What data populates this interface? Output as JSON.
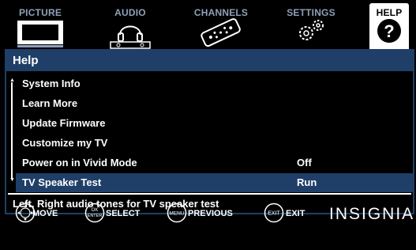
{
  "tabs": [
    {
      "label": "PICTURE",
      "icon": "tv-icon",
      "active": false
    },
    {
      "label": "AUDIO",
      "icon": "headphones-icon",
      "active": false
    },
    {
      "label": "CHANNELS",
      "icon": "remote-icon",
      "active": false
    },
    {
      "label": "SETTINGS",
      "icon": "gears-icon",
      "active": false
    },
    {
      "label": "HELP",
      "icon": "question-icon",
      "active": true
    }
  ],
  "panel": {
    "title": "Help",
    "items": [
      {
        "label": "System Info",
        "value": ""
      },
      {
        "label": "Learn More",
        "value": ""
      },
      {
        "label": "Update Firmware",
        "value": ""
      },
      {
        "label": "Customize my TV",
        "value": ""
      },
      {
        "label": "Power on in Vivid Mode",
        "value": "Off"
      },
      {
        "label": "TV Speaker Test",
        "value": "Run",
        "selected": true
      }
    ],
    "description": "Left, Right audio tones for TV speaker test"
  },
  "footer": {
    "move": "MOVE",
    "ok_top": "OK",
    "ok_bottom": "ENTER",
    "select": "SELECT",
    "menu_btn": "MENU",
    "previous": "PREVIOUS",
    "exit_btn": "EXIT",
    "exit": "EXIT",
    "brand": "INSIGNIA"
  },
  "colors": {
    "accent": "#1f3f68",
    "tab_label": "#8fa0b8"
  }
}
